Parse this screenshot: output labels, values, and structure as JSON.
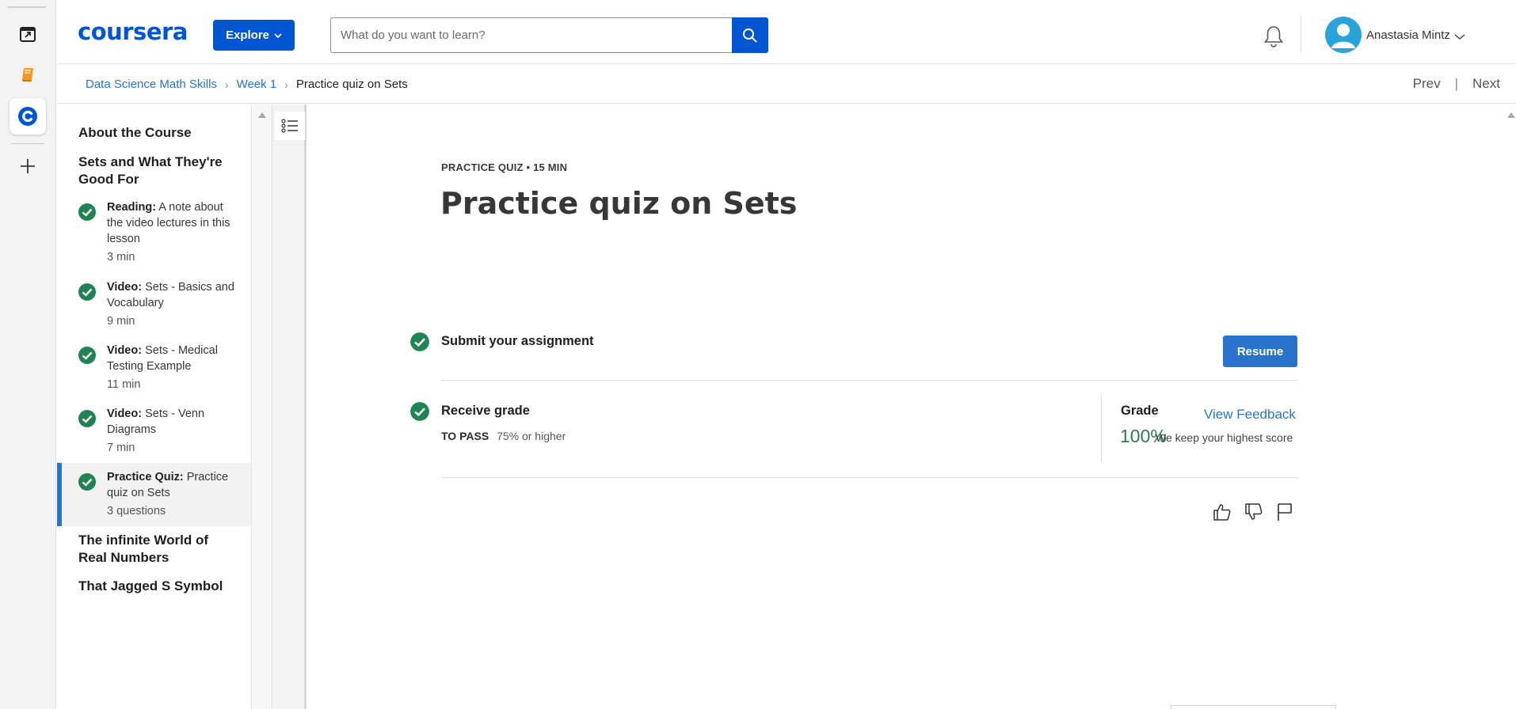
{
  "app_strip": {
    "items": [
      "calendar-icon",
      "book-icon",
      "coursera-icon",
      "plus-icon"
    ]
  },
  "header": {
    "logo": "coursera",
    "explore_label": "Explore",
    "search": {
      "placeholder": "What do you want to learn?",
      "value": ""
    },
    "user_name": "Anastasia Mintz"
  },
  "breadcrumb": {
    "items": [
      "Data Science Math Skills",
      "Week 1",
      "Practice quiz on Sets"
    ],
    "prev": "Prev",
    "next": "Next",
    "separator": "|"
  },
  "sidebar": {
    "sections": [
      {
        "title": "About the Course"
      },
      {
        "title": "Sets and What They're Good For"
      },
      {
        "title": "The infinite World of Real Numbers"
      },
      {
        "title": "That Jagged S Symbol"
      }
    ],
    "items": [
      {
        "type": "Reading:",
        "title": "A note about the video lectures in this lesson",
        "meta": "3 min",
        "completed": true
      },
      {
        "type": "Video:",
        "title": "Sets - Basics and Vocabulary",
        "meta": "9 min",
        "completed": true
      },
      {
        "type": "Video:",
        "title": "Sets - Medical Testing Example",
        "meta": "11 min",
        "completed": true
      },
      {
        "type": "Video:",
        "title": "Sets - Venn Diagrams",
        "meta": "7 min",
        "completed": true
      },
      {
        "type": "Practice Quiz:",
        "title": "Practice quiz on Sets",
        "meta": "3 questions",
        "completed": true,
        "active": true
      }
    ]
  },
  "main": {
    "kicker": "PRACTICE QUIZ • 15 MIN",
    "title": "Practice quiz on Sets",
    "submit_label": "Submit your assignment",
    "resume_label": "Resume",
    "receive_label": "Receive grade",
    "to_pass_label": "TO PASS",
    "to_pass_value": "75% or higher",
    "grade_label": "Grade",
    "grade_value": "100%",
    "view_feedback": "View Feedback",
    "highest_note": "We keep your highest score"
  },
  "colors": {
    "brand": "#0056d2",
    "link": "#2a73cc",
    "success": "#2f7d51",
    "check": "#1f8354"
  }
}
